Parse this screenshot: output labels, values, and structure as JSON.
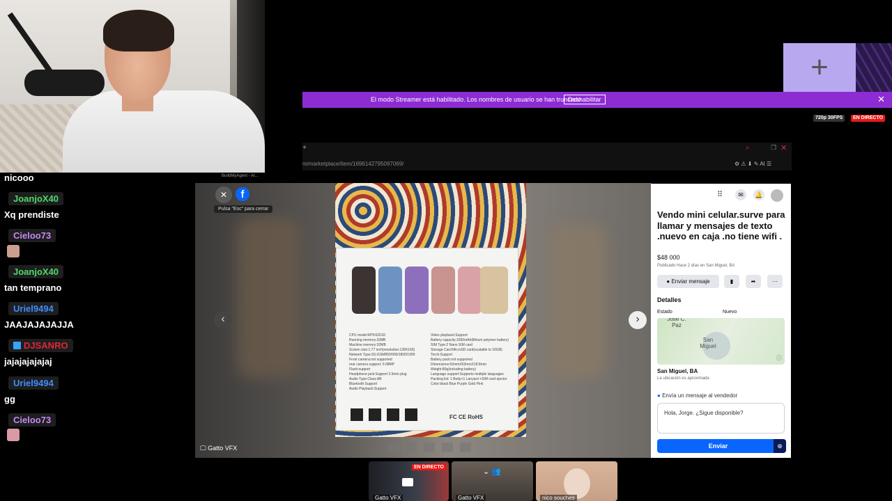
{
  "chat": {
    "messages": [
      {
        "user": "",
        "text": "nicooo"
      },
      {
        "user": "JoanjoX40",
        "text": "Xq prendiste",
        "color": "#4dd96a"
      },
      {
        "user": "Cieloo73",
        "text": "",
        "color": "#c58af9"
      },
      {
        "user": "JoanjoX40",
        "text": "tan temprano",
        "color": "#4dd96a"
      },
      {
        "user": "Uriel9494",
        "text": "JAAJAJAJAJJA",
        "color": "#3f8cff"
      },
      {
        "user": "DJSANRO",
        "text": "jajajajajajaj",
        "color": "#e0263a"
      },
      {
        "user": "Uriel9494",
        "text": "gg",
        "color": "#3f8cff"
      },
      {
        "user": "Cieloo73",
        "text": "",
        "color": "#c58af9"
      }
    ]
  },
  "banner": {
    "text": "El modo Streamer está habilitado. Los nombres de usuario se han truncado.",
    "button": "Deshabilitar"
  },
  "stream": {
    "quality": "720p 30FPS",
    "live": "EN DIRECTO"
  },
  "browser": {
    "url": "m/marketplace/item/1696142795097069/",
    "tab": "BuildMyAgent - AI..."
  },
  "viewer": {
    "close_hint": "Pulsa \"Esc\" para cerrar"
  },
  "listing": {
    "title": "Vendo mini celular.surve para llamar y mensajes de texto .nuevo en caja .no tiene wifi .",
    "price": "$48 000",
    "published": "Publicado Hace 2 días en San Miguel, BA",
    "message_button": "Enviar mensaje",
    "details_heading": "Detalles",
    "state_label": "Estado",
    "state_value": "Nuevo",
    "map_label_1": "José C. Paz",
    "map_label_2": "San Miguel",
    "location": "San Miguel, BA",
    "location_note": "La ubicación es aproximada",
    "seller_prompt": "Envía un mensaje al vendedor",
    "message_text": "Hola, Jorge. ¿Sigue disponible?",
    "send_button": "Enviar"
  },
  "box_specs_left": [
    "CPU model:MTK6261D",
    "Running memory:32MB",
    "Machine memory:32MB",
    "Screen size:1.77 inch(resolution:128X160)",
    "Network Type:2G:GSM850/900/1800/1900",
    "Front camera:not supported",
    "rear camera support: 0.08MP",
    "Flash:support",
    "Headphone jack:Support 3.5mm plug",
    "Audio Type:Class AB",
    "Bluetooth:Support",
    "Audio Playback:Support"
  ],
  "box_specs_right": [
    "Video playback:Support",
    "Battery capacity:1500mAh(lithium polymer battery)",
    "SIM Type:2 Nano SIM card",
    "Storage Card:MicroSD card(scalable to 16GB)",
    "Torch:Support",
    "Battery pack:not supported",
    "Dimensions:63mmX63mmX18.8mm",
    "Weight:80g(including battery)",
    "Language support:Supports multiple languages",
    "Packing list: 1 Body+1 Lanyard +SIM card ejector",
    "Color:black Blue Purple Gold Pink"
  ],
  "box_marks": "FC CE RoHS",
  "tiles": [
    {
      "label": "Gatto VFX",
      "live": "EN DIRECTO"
    },
    {
      "label": "Gatto VFX"
    },
    {
      "label": "nico souches"
    }
  ],
  "screen_label": "Gatto VFX",
  "banner_colors": {
    "accent": "#8e2cd4",
    "fb_blue": "#0866ff"
  }
}
